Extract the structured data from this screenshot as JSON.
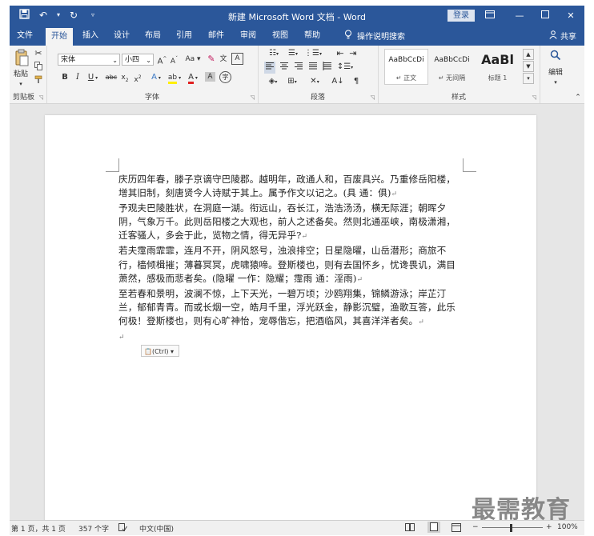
{
  "window": {
    "title": "新建 Microsoft Word 文档 - Word",
    "login": "登录",
    "quick_access": [
      "save-icon",
      "undo-icon",
      "redo-icon",
      "customize-icon"
    ],
    "controls": [
      "restore-ribbon-icon",
      "minimize-icon",
      "maximize-icon",
      "close-icon"
    ]
  },
  "tabs": [
    "文件",
    "开始",
    "插入",
    "设计",
    "布局",
    "引用",
    "邮件",
    "审阅",
    "视图",
    "帮助"
  ],
  "active_tab": "开始",
  "tell_me": "操作说明搜索",
  "share": "共享",
  "ribbon": {
    "clipboard": {
      "paste": "粘贴",
      "label": "剪贴板"
    },
    "font": {
      "name": "宋体",
      "size": "小四",
      "label": "字体"
    },
    "paragraph": {
      "label": "段落"
    },
    "styles": {
      "items": [
        {
          "sample": "AaBbCcDi",
          "name": "↵ 正文"
        },
        {
          "sample": "AaBbCcDi",
          "name": "↵ 无间隔"
        },
        {
          "sample": "AaBl",
          "name": "标题 1"
        }
      ],
      "label": "样式"
    },
    "editing": {
      "label": "编辑"
    }
  },
  "document": {
    "paragraphs": [
      "庆历四年春，滕子京谪守巴陵郡。越明年，政通人和，百废具兴。乃重修岳阳楼，增其旧制，刻唐贤今人诗赋于其上。属予作文以记之。(具  通：俱)",
      "予观夫巴陵胜状，在洞庭一湖。衔远山，吞长江，浩浩汤汤，横无际涯；朝晖夕阴，气象万千。此则岳阳楼之大观也，前人之述备矣。然则北通巫峡，南极潇湘，迁客骚人，多会于此，览物之情，得无异乎?",
      "若夫霪雨霏霏，连月不开，阴风怒号，浊浪排空；日星隐曜，山岳潜形；商旅不行，樯倾楫摧；薄暮冥冥，虎啸猿啼。登斯楼也，则有去国怀乡，忧谗畏讥，满目萧然，感极而悲者矣。(隐曜  一作：隐耀；霪雨  通：淫雨)",
      "至若春和景明，波澜不惊，上下天光，一碧万顷；沙鸥翔集，锦鳞游泳；岸芷汀兰，郁郁青青。而或长烟一空，皓月千里，浮光跃金，静影沉璧，渔歌互答，此乐何极！登斯楼也，则有心旷神怡，宠辱偕忘，把酒临风，其喜洋洋者矣。"
    ],
    "paste_options": "(Ctrl)"
  },
  "status": {
    "page": "第 1 页，共 1 页",
    "words": "357 个字",
    "language": "中文(中国)",
    "zoom": "100%"
  },
  "watermark": "最需教育"
}
